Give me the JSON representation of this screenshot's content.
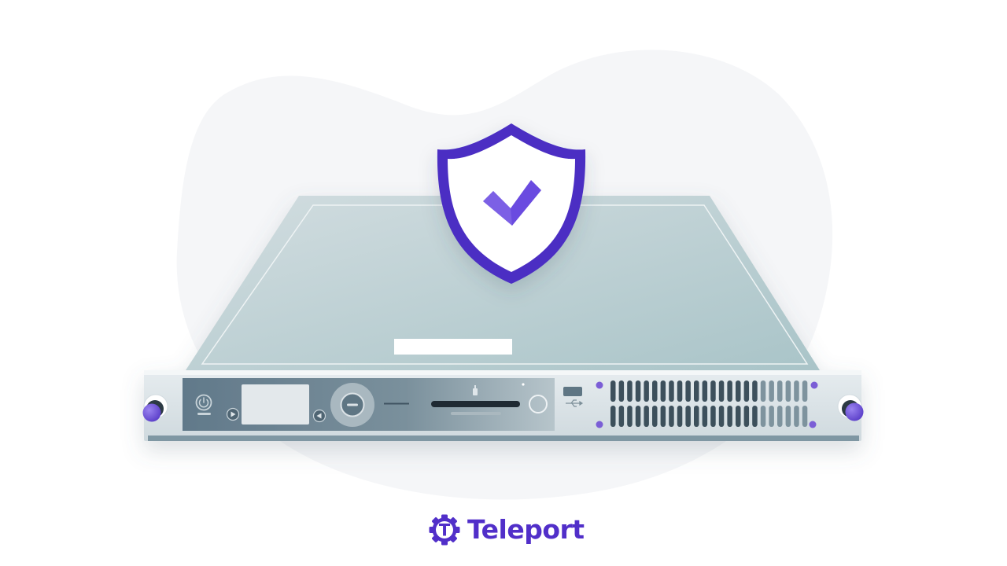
{
  "brand": {
    "name": "Teleport",
    "logo_letter": "T",
    "color": "#512fc9"
  },
  "illustration": {
    "subject": "rack-server",
    "badge_icon": "shield-check-icon",
    "blob_color": "#f5f6f8",
    "shield_color": "#4b2ec3",
    "accent_color": "#7b5ed6",
    "server_top_color": "#c8d6da",
    "server_front_color": "#dde4e8",
    "panel_color": "#6c8490"
  }
}
